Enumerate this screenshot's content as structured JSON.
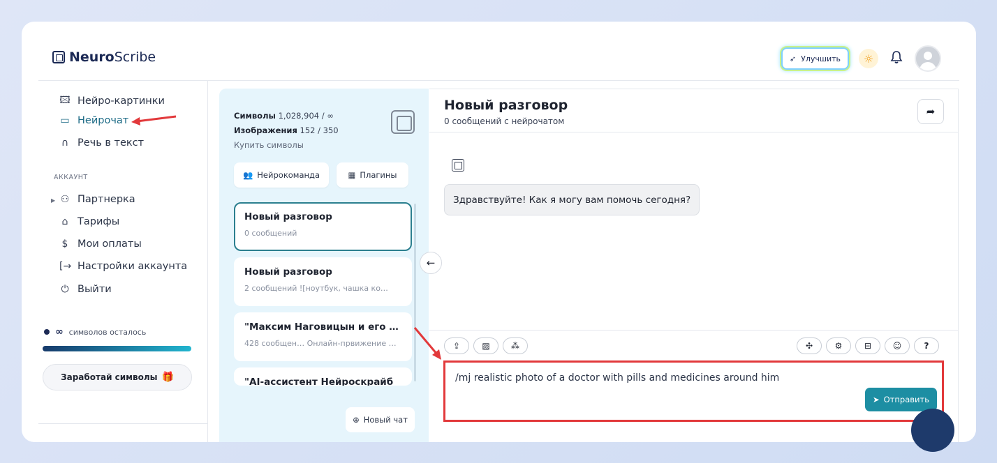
{
  "header": {
    "logo_bold": "Neuro",
    "logo_light": "Scribe",
    "upgrade_label": "Улучшить"
  },
  "sidebar": {
    "items": [
      {
        "label": "Нейро-картинки",
        "icon": "image-icon"
      },
      {
        "label": "Нейрочат",
        "icon": "chat-icon"
      },
      {
        "label": "Речь в текст",
        "icon": "headphones-icon"
      }
    ],
    "account_label": "АККАУНТ",
    "account_items": [
      {
        "label": "Партнерка",
        "icon": "users-icon"
      },
      {
        "label": "Тарифы",
        "icon": "tag-icon"
      },
      {
        "label": "Мои оплаты",
        "icon": "dollar-icon"
      },
      {
        "label": "Настройки аккаунта",
        "icon": "login-icon"
      },
      {
        "label": "Выйти",
        "icon": "power-icon"
      }
    ],
    "remaining_symbol": "∞",
    "remaining_text": "символов осталось",
    "progress": 1.0,
    "earn_label": "Заработай символы"
  },
  "chatlist": {
    "symbols_label": "Символы",
    "symbols_value": "1,028,904 / ∞",
    "images_label": "Изображения",
    "images_value": "152 / 350",
    "buy_label": "Купить символы",
    "team_button": "Нейрокоманда",
    "plugins_button": "Плагины",
    "chats": [
      {
        "title": "Новый разговор",
        "sub": "0 сообщений"
      },
      {
        "title": "Новый разговор",
        "sub": "2 сообщений    ![ноутбук, чашка ко…"
      },
      {
        "title": "\"Максим Наговицын и его …",
        "sub": "428 сообщен… Онлайн-првижение …"
      },
      {
        "title": "\"AI-ассистент Нейроскрайб",
        "sub": ""
      }
    ],
    "new_chat_label": "Новый чат"
  },
  "chat": {
    "title": "Новый разговор",
    "subtitle": "0 сообщений с нейрочатом",
    "greeting": "Здравствуйте! Как я могу вам помочь сегодня?",
    "input_text": "/mj realistic photo of a doctor with pills and medicines around him",
    "send_label": "Отправить"
  },
  "colors": {
    "accent": "#1d8ea3",
    "highlight": "#e2393b",
    "active_nav": "#1d6b86"
  }
}
